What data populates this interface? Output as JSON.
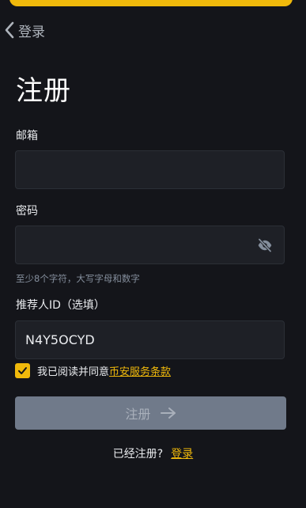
{
  "header": {
    "back_label": "登录"
  },
  "page": {
    "title": "注册"
  },
  "form": {
    "email": {
      "label": "邮箱",
      "value": "",
      "placeholder": ""
    },
    "password": {
      "label": "密码",
      "value": "",
      "placeholder": "",
      "hint": "至少8个字符，大写字母和数字"
    },
    "referral": {
      "label": "推荐人ID（选填）",
      "value": "N4Y5OCYD"
    },
    "agreement": {
      "checked": true,
      "prefix": "我已阅读并同意",
      "link_label": "币安服务条款"
    },
    "submit_label": "注册"
  },
  "footer": {
    "prompt": "已经注册?",
    "login_label": "登录"
  },
  "colors": {
    "background": "#14151a",
    "accent": "#f0b90b",
    "input_bg": "#1e2026",
    "button_disabled": "#707a8a"
  },
  "icons": {
    "back": "chevron-left-icon",
    "password_toggle": "eye-off-icon",
    "checkbox": "check-icon",
    "submit_arrow": "arrow-right-icon"
  }
}
